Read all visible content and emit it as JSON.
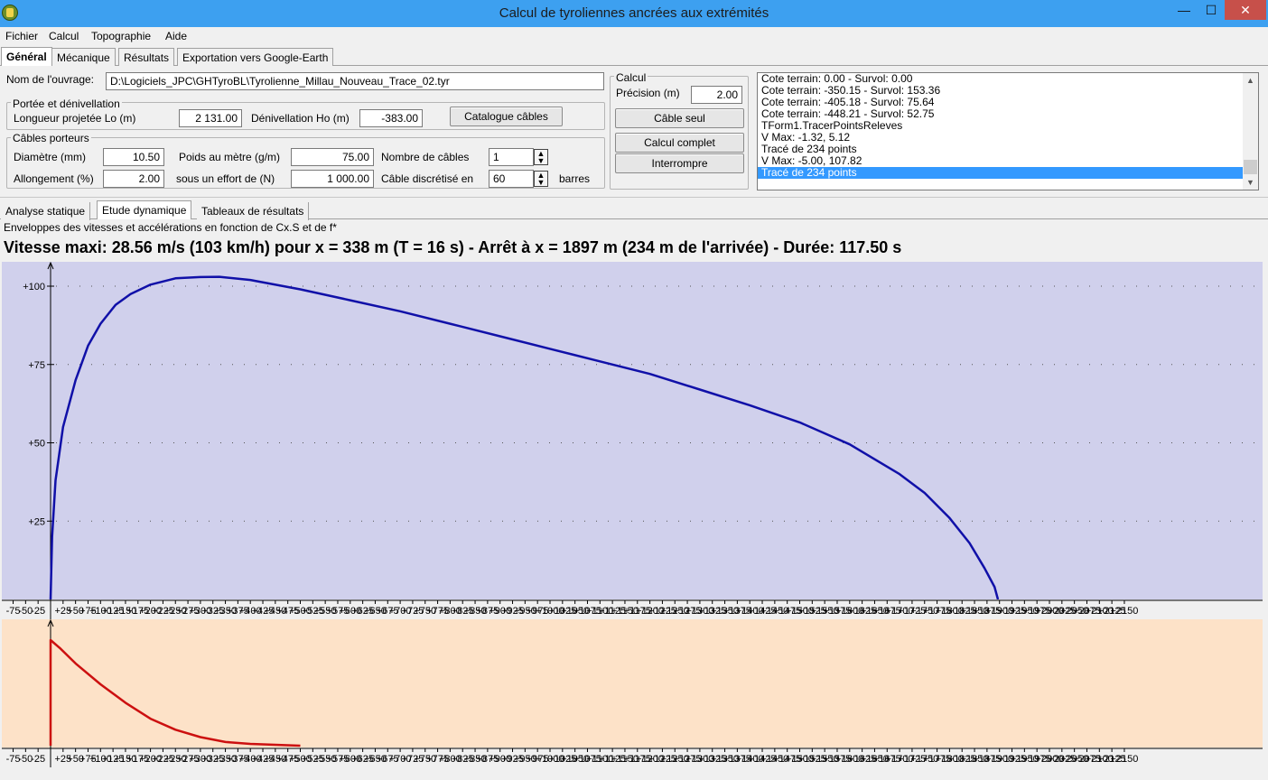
{
  "window": {
    "title": "Calcul de tyroliennes ancrées aux extrémités",
    "minimize": "—",
    "maximize": "☐",
    "close": "✕"
  },
  "menu": [
    "Fichier",
    "Calcul",
    "Topographie",
    "Aide"
  ],
  "main_tabs": [
    "Général",
    "Mécanique",
    "Résultats",
    "Exportation vers Google-Earth"
  ],
  "general": {
    "ouvrage_label": "Nom de l'ouvrage:",
    "ouvrage_value": "D:\\Logiciels_JPC\\GHTyroBL\\Tyrolienne_Millau_Nouveau_Trace_02.tyr",
    "portee": {
      "legend": "Portée et dénivellation",
      "longueur_label": "Longueur projetée Lo (m)",
      "longueur_value": "2 131.00",
      "deniv_label": "Dénivellation Ho (m)",
      "deniv_value": "-383.00",
      "catalogue_button": "Catalogue câbles"
    },
    "cables": {
      "legend": "Câbles porteurs",
      "diametre_label": "Diamètre (mm)",
      "diametre_value": "10.50",
      "poids_label": "Poids au mètre (g/m)",
      "poids_value": "75.00",
      "nombre_label": "Nombre de câbles",
      "nombre_value": "1",
      "allongement_label": "Allongement (%)",
      "allongement_value": "2.00",
      "effort_label": "sous un effort de (N)",
      "effort_value": "1 000.00",
      "discretise_label": "Câble discrétisé en",
      "discretise_value": "60",
      "barres_label": "barres"
    },
    "calcul": {
      "legend": "Calcul",
      "precision_label": "Précision (m)",
      "precision_value": "2.00",
      "cable_seul_button": "Câble seul",
      "calcul_complet_button": "Calcul complet",
      "interrompre_button": "Interrompre"
    }
  },
  "log": [
    "Cote terrain: 0.00 - Survol: 0.00",
    "Cote terrain: -350.15 - Survol: 153.36",
    "Cote terrain: -405.18 - Survol: 75.64",
    "Cote terrain: -448.21 - Survol: 52.75",
    "TForm1.TracerPointsReleves",
    "V Max: -1.32, 5.12",
    "Tracé de 234 points",
    "V Max: -5.00, 107.82",
    "Tracé de 234 points"
  ],
  "log_selected_index": 8,
  "results_tabs": [
    "Analyse statique",
    "Etude dynamique",
    "Tableaux de résultats"
  ],
  "subtitle": "Enveloppes des vitesses et accélérations en fonction de Cx.S et de f*",
  "headline": "Vitesse maxi: 28.56 m/s (103 km/h) pour x = 338 m (T = 16 s) - Arrêt à x = 1897 m (234 m de l'arrivée) - Durée: 117.50 s",
  "colors": {
    "speed_curve": "#1010a8",
    "accel_curve": "#cc1010",
    "speed_bg": "#d0d0ec",
    "accel_bg": "#fde2c8",
    "selection": "#3399ff"
  },
  "chart_data": [
    {
      "type": "line",
      "title": "",
      "xlabel": "",
      "ylabel": "",
      "y_ticks": [
        "+25",
        "+50",
        "+75",
        "+100"
      ],
      "y_tick_values": [
        25,
        50,
        75,
        100
      ],
      "ylim": [
        0,
        108
      ],
      "xlim": [
        -85,
        2155
      ],
      "grid": "dotted",
      "x_tick_labels": [
        "-75",
        "-50",
        "-25",
        "+25",
        "+50",
        "+75",
        "+100",
        "+125",
        "+150",
        "+175",
        "+200",
        "+225",
        "+250",
        "+275",
        "+300",
        "+325",
        "+350",
        "+375",
        "+400",
        "+425",
        "+450",
        "+475",
        "+500",
        "+525",
        "+550",
        "+575",
        "+600",
        "+625",
        "+650",
        "+675",
        "+700",
        "+725",
        "+750",
        "+775",
        "+800",
        "+825",
        "+850",
        "+875",
        "+900",
        "+925",
        "+950",
        "+975",
        "+1000",
        "+1025",
        "+1050",
        "+1075",
        "+1100",
        "+1125",
        "+1150",
        "+1175",
        "+1200",
        "+1225",
        "+1250",
        "+1275",
        "+1300",
        "+1325",
        "+1350",
        "+1375",
        "+1400",
        "+1425",
        "+1450",
        "+1475",
        "+1500",
        "+1525",
        "+1550",
        "+1575",
        "+1600",
        "+1625",
        "+1650",
        "+1675",
        "+1700",
        "+1725",
        "+1750",
        "+1775",
        "+1800",
        "+1825",
        "+1850",
        "+1875",
        "+1900",
        "+1925",
        "+1950",
        "+1975",
        "+2000",
        "+2025",
        "+2050",
        "+2075",
        "+2100",
        "+2125",
        "+2150"
      ],
      "x_tick_values": [
        -75,
        -50,
        -25,
        25,
        50,
        75,
        100,
        125,
        150,
        175,
        200,
        225,
        250,
        275,
        300,
        325,
        350,
        375,
        400,
        425,
        450,
        475,
        500,
        525,
        550,
        575,
        600,
        625,
        650,
        675,
        700,
        725,
        750,
        775,
        800,
        825,
        850,
        875,
        900,
        925,
        950,
        975,
        1000,
        1025,
        1050,
        1075,
        1100,
        1125,
        1150,
        1175,
        1200,
        1225,
        1250,
        1275,
        1300,
        1325,
        1350,
        1375,
        1400,
        1425,
        1450,
        1475,
        1500,
        1525,
        1550,
        1575,
        1600,
        1625,
        1650,
        1675,
        1700,
        1725,
        1750,
        1775,
        1800,
        1825,
        1850,
        1875,
        1900,
        1925,
        1950,
        1975,
        2000,
        2025,
        2050,
        2075,
        2100,
        2125,
        2150
      ],
      "series": [
        {
          "x": [
            0,
            3,
            10,
            25,
            50,
            75,
            100,
            130,
            160,
            200,
            250,
            300,
            338,
            400,
            500,
            600,
            700,
            800,
            900,
            1000,
            1100,
            1200,
            1300,
            1400,
            1500,
            1600,
            1700,
            1750,
            1800,
            1840,
            1870,
            1890,
            1897
          ],
          "y": [
            0,
            20,
            38,
            55,
            70,
            81,
            88,
            94,
            97.5,
            100.5,
            102.5,
            102.9,
            103,
            102,
            99,
            95.5,
            92,
            88,
            84,
            80,
            76,
            72,
            67,
            62,
            56.5,
            49.5,
            40,
            34,
            26,
            18,
            10,
            4,
            0
          ]
        }
      ]
    },
    {
      "type": "line",
      "title": "",
      "xlabel": "",
      "ylabel": "",
      "ylim": [
        0,
        1
      ],
      "xlim": [
        -85,
        2155
      ],
      "series": [
        {
          "x": [
            0,
            0,
            20,
            50,
            100,
            150,
            200,
            250,
            300,
            350,
            400,
            500
          ],
          "y": [
            0,
            0.86,
            0.79,
            0.67,
            0.5,
            0.35,
            0.22,
            0.13,
            0.07,
            0.03,
            0.015,
            0
          ]
        }
      ]
    }
  ]
}
